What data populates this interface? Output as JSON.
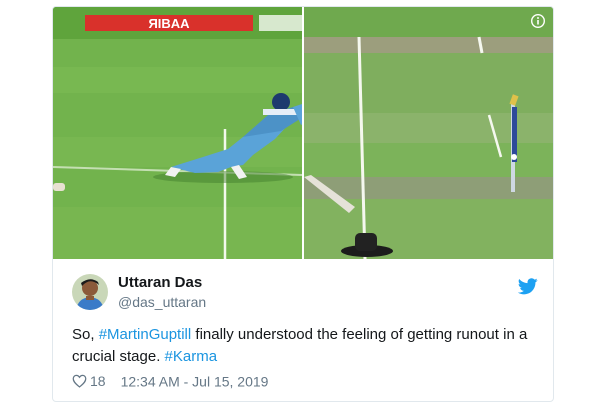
{
  "tweet": {
    "display_name": "Uttaran Das",
    "handle": "@das_uttaran",
    "text_parts": {
      "lead": "So, ",
      "hashtag_1": "#MartinGuptill",
      "middle": " finally understood the feeling of getting runout in a crucial stage. ",
      "hashtag_2": "#Karma"
    },
    "likes": "18",
    "timestamp": "12:34 AM - Jul 15, 2019"
  },
  "media": {
    "billboard_text": "ЯIBAA"
  },
  "icons": {
    "info": "info-icon",
    "bird": "twitter-bird-icon",
    "heart": "heart-icon"
  },
  "colors": {
    "hashtag": "#1b95e0",
    "bird": "#1da1f2",
    "text": "#14171a",
    "muted": "#657786",
    "grass": "#6bb04a",
    "kit": "#5aa3d8"
  }
}
